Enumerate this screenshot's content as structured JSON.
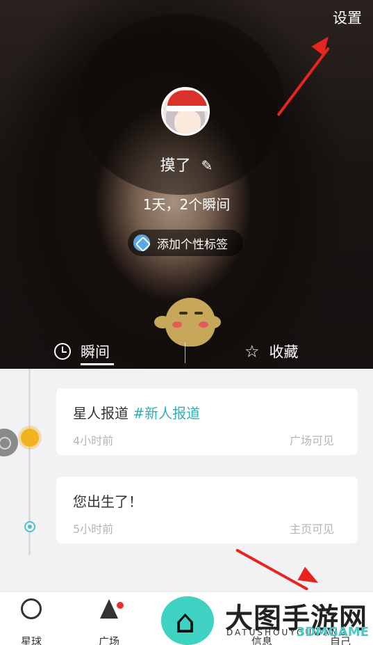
{
  "header": {
    "settings_label": "设置"
  },
  "profile": {
    "nickname": "摸了",
    "edit_icon": "✎",
    "stats": "1天，2个瞬间",
    "add_tag_label": "添加个性标签"
  },
  "tabs": {
    "moments_label": "瞬间",
    "favorites_label": "收藏",
    "favorites_icon": "☆"
  },
  "feed": [
    {
      "title": "星人报道",
      "tag": "#新人报道",
      "time": "4小时前",
      "visibility": "广场可见"
    },
    {
      "title": "您出生了！",
      "tag": "",
      "time": "5小时前",
      "visibility": "主页可见"
    }
  ],
  "tabbar": {
    "items": [
      {
        "label": "星球",
        "icon": "planet-icon"
      },
      {
        "label": "广场",
        "icon": "cone-icon"
      },
      {
        "label": "信息",
        "icon": "message-icon"
      },
      {
        "label": "自己",
        "icon": "profile-icon"
      }
    ]
  },
  "watermark": {
    "title": "大图手游网",
    "subtitle": "DATUSHOUYOUWANG",
    "brand": "3DMGAME"
  },
  "colors": {
    "accent": "#2ab3b5",
    "annotation_arrow": "#e8241f",
    "badge": "#e8312b"
  }
}
